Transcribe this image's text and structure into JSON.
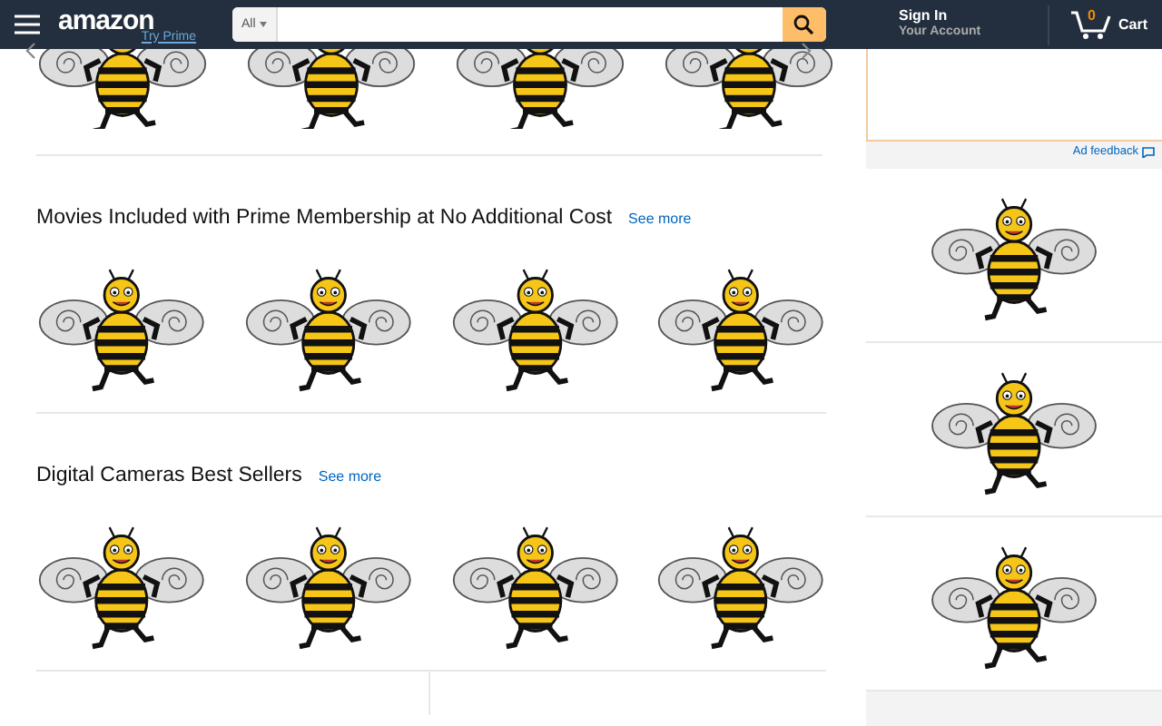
{
  "header": {
    "logo": "amazon",
    "prime_link": "Try Prime",
    "search": {
      "category": "All"
    },
    "account": {
      "title": "Sign In",
      "subtitle": "Your Account"
    },
    "cart": {
      "count": "0",
      "label": "Cart"
    }
  },
  "sections": [
    {
      "kind": "carousel"
    },
    {
      "kind": "titled",
      "title": "Movies Included with Prime Membership at No Additional Cost",
      "link": "See more"
    },
    {
      "kind": "titled",
      "title": "Digital Cameras Best Sellers",
      "link": "See more"
    }
  ],
  "sidebar": {
    "ad_feedback": "Ad feedback"
  }
}
